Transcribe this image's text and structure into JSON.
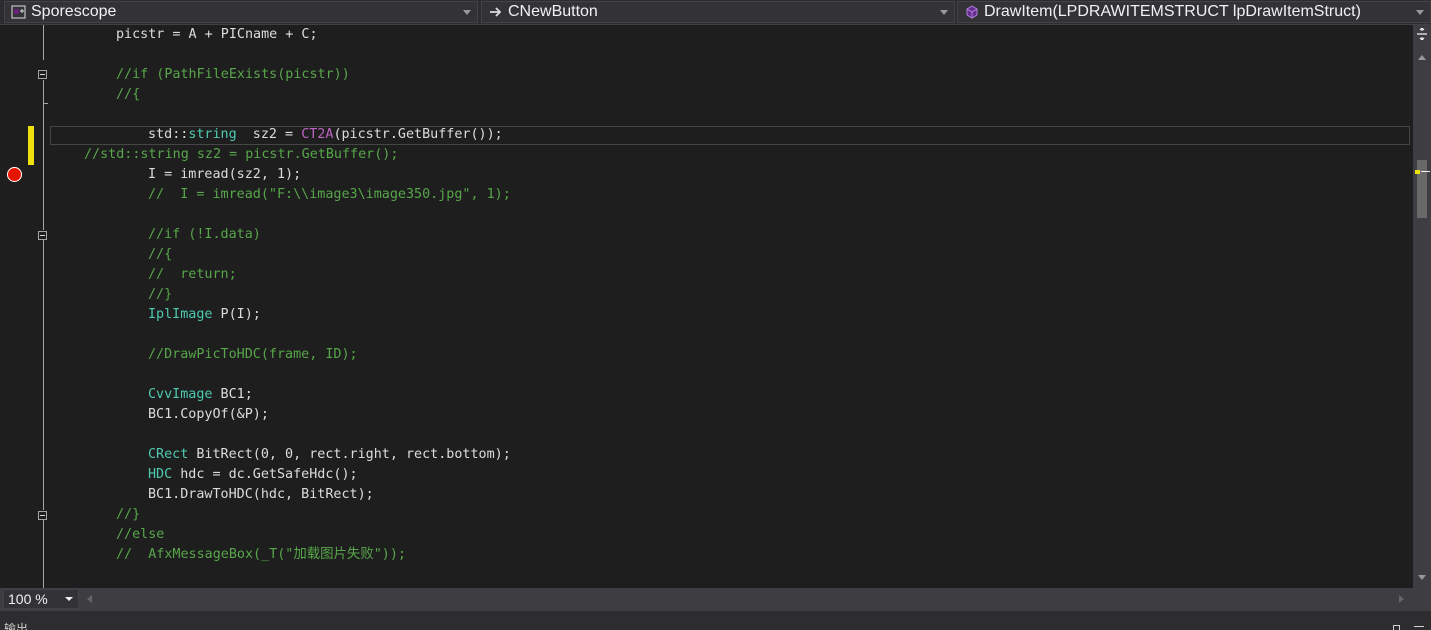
{
  "navigation": {
    "project": "Sporescope",
    "type": "CNewButton",
    "member": "DrawItem(LPDRAWITEMSTRUCT lpDrawItemStruct)"
  },
  "code": [
    {
      "segments": [
        {
          "k": "txt",
          "text": "picstr = A + PICname + C;"
        }
      ]
    },
    {
      "segments": []
    },
    {
      "segments": [
        {
          "k": "cm",
          "text": "//if (PathFileExists(picstr))"
        }
      ]
    },
    {
      "segments": [
        {
          "k": "cm",
          "text": "//{"
        }
      ]
    },
    {
      "segments": []
    },
    {
      "segments": [
        {
          "k": "sel",
          "text": "std"
        },
        {
          "k": "txt",
          "text": "::"
        },
        {
          "k": "ty",
          "text": "string"
        },
        {
          "k": "txt",
          "text": "  sz2 = "
        },
        {
          "k": "mac",
          "text": "CT2A"
        },
        {
          "k": "txt",
          "text": "(picstr.GetBuffer());"
        }
      ]
    },
    {
      "segments": [
        {
          "k": "cm",
          "text": "//std::string sz2 = picstr.GetBuffer();"
        }
      ]
    },
    {
      "segments": [
        {
          "k": "txt",
          "text": "I = imread(sz2, 1);"
        }
      ]
    },
    {
      "segments": [
        {
          "k": "cm",
          "text": "//  I = imread(\"F:\\\\image3\\image350.jpg\", 1);"
        }
      ]
    },
    {
      "segments": []
    },
    {
      "segments": [
        {
          "k": "cm",
          "text": "//if (!I.data)"
        }
      ]
    },
    {
      "segments": [
        {
          "k": "cm",
          "text": "//{"
        }
      ]
    },
    {
      "segments": [
        {
          "k": "cm",
          "text": "//  return;"
        }
      ]
    },
    {
      "segments": [
        {
          "k": "cm",
          "text": "//}"
        }
      ]
    },
    {
      "segments": [
        {
          "k": "ty",
          "text": "IplImage"
        },
        {
          "k": "txt",
          "text": " P(I);"
        }
      ]
    },
    {
      "segments": []
    },
    {
      "segments": [
        {
          "k": "cm",
          "text": "//DrawPicToHDC(frame, ID);"
        }
      ]
    },
    {
      "segments": []
    },
    {
      "segments": [
        {
          "k": "ty",
          "text": "CvvImage"
        },
        {
          "k": "txt",
          "text": " BC1;"
        }
      ]
    },
    {
      "segments": [
        {
          "k": "txt",
          "text": "BC1.CopyOf(&P);"
        }
      ]
    },
    {
      "segments": []
    },
    {
      "segments": [
        {
          "k": "ty",
          "text": "CRect"
        },
        {
          "k": "txt",
          "text": " BitRect(0, 0, rect.right, rect.bottom);"
        }
      ]
    },
    {
      "segments": [
        {
          "k": "ty",
          "text": "HDC"
        },
        {
          "k": "txt",
          "text": " hdc = dc.GetSafeHdc();"
        }
      ]
    },
    {
      "segments": [
        {
          "k": "txt",
          "text": "BC1.DrawToHDC(hdc, BitRect);"
        }
      ]
    },
    {
      "segments": [
        {
          "k": "cm",
          "text": "//}"
        }
      ]
    },
    {
      "segments": [
        {
          "k": "cm",
          "text": "//else"
        }
      ]
    },
    {
      "segments": [
        {
          "k": "cm",
          "text": "//  AfxMessageBox(_T(\"加载图片失败\"));"
        }
      ]
    }
  ],
  "editor": {
    "zoom": "100 %"
  },
  "output": {
    "title": "输出"
  }
}
